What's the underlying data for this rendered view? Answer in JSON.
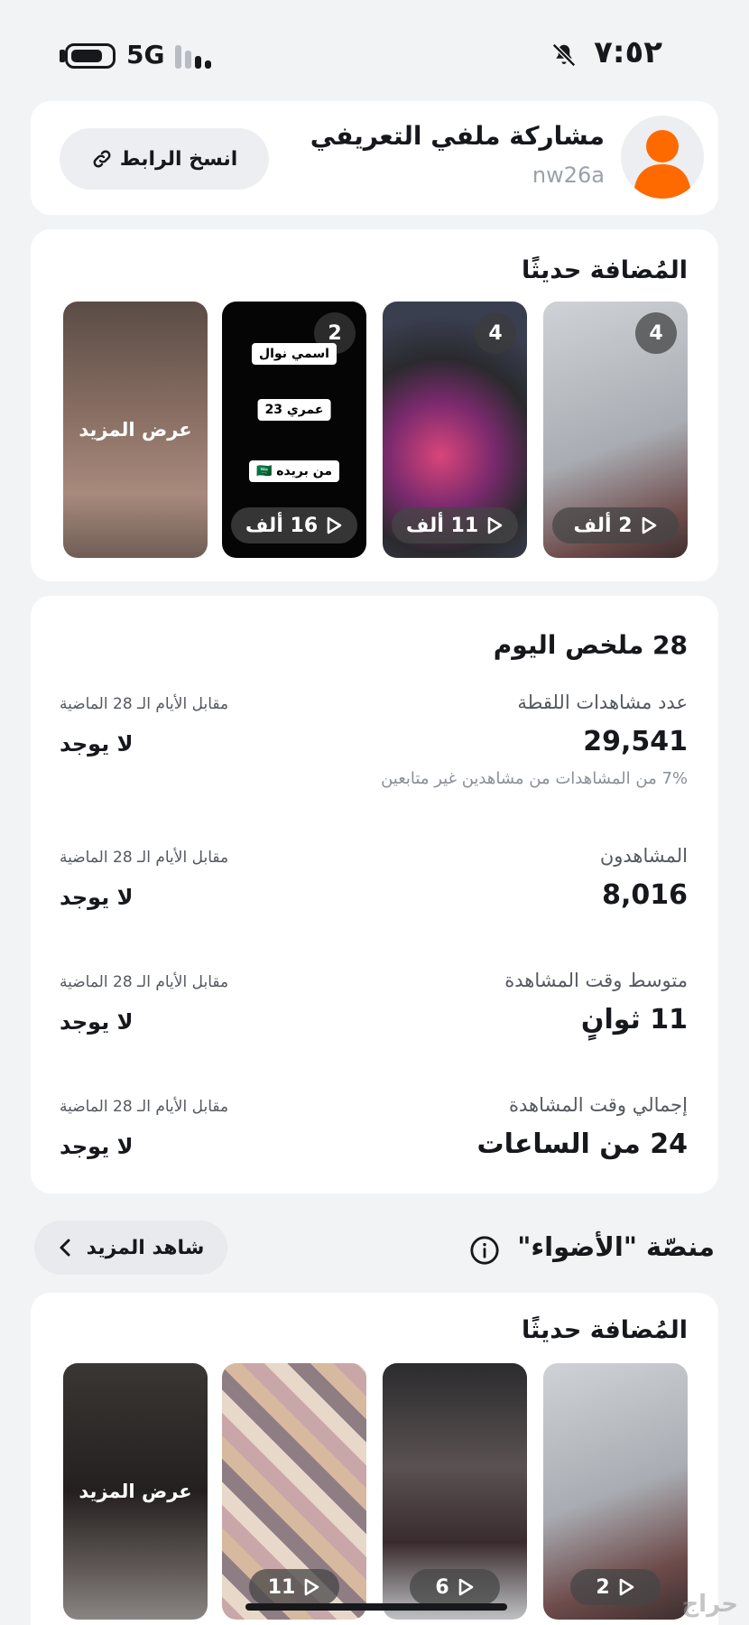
{
  "status_bar": {
    "time": "٧:٥٢",
    "network": "5G",
    "battery_icon": "battery-icon",
    "bell_icon": "bell-muted-icon"
  },
  "profile": {
    "title": "مشاركة ملفي التعريفي",
    "username": "nw26a",
    "copy_link_label": "انسخ الرابط",
    "avatar_icon": "user-avatar-icon",
    "link_icon": "link-icon"
  },
  "recent": {
    "title": "المُضافة حديثًا",
    "items": [
      {
        "badge": "4",
        "views": "2 ألف"
      },
      {
        "badge": "4",
        "views": "11 ألف"
      },
      {
        "badge": "2",
        "views": "16 ألف",
        "stickers": [
          "اسمي نوال",
          "عمري 23",
          "من بريده 🇸🇦"
        ]
      },
      {
        "more_label": "عرض المزيد"
      }
    ]
  },
  "summary": {
    "title": "28 ملخص اليوم",
    "compare_label": "مقابل الأيام الـ 28 الماضية",
    "metrics": [
      {
        "label": "عدد مشاهدات اللقطة",
        "value": "29,541",
        "compare": "لا يوجد",
        "note": "7% من المشاهدات من مشاهدين غير متابعين"
      },
      {
        "label": "المشاهدون",
        "value": "8,016",
        "compare": "لا يوجد"
      },
      {
        "label": "متوسط وقت المشاهدة",
        "value": "11 ثوانٍ",
        "compare": "لا يوجد"
      },
      {
        "label": "إجمالي وقت المشاهدة",
        "value": "24 من الساعات",
        "compare": "لا يوجد"
      }
    ]
  },
  "spotlight": {
    "title": "منصّة \"الأضواء\"",
    "see_more_label": "شاهد المزيد",
    "recent_title": "المُضافة حديثًا",
    "items": [
      {
        "views": "2"
      },
      {
        "views": "6"
      },
      {
        "views": "11"
      },
      {
        "more_label": "عرض المزيد"
      }
    ]
  },
  "watermark": "حراج",
  "colors": {
    "background": "#f2f3f5",
    "card": "#ffffff",
    "text": "#16181c",
    "avatar": "#ff6a00"
  }
}
